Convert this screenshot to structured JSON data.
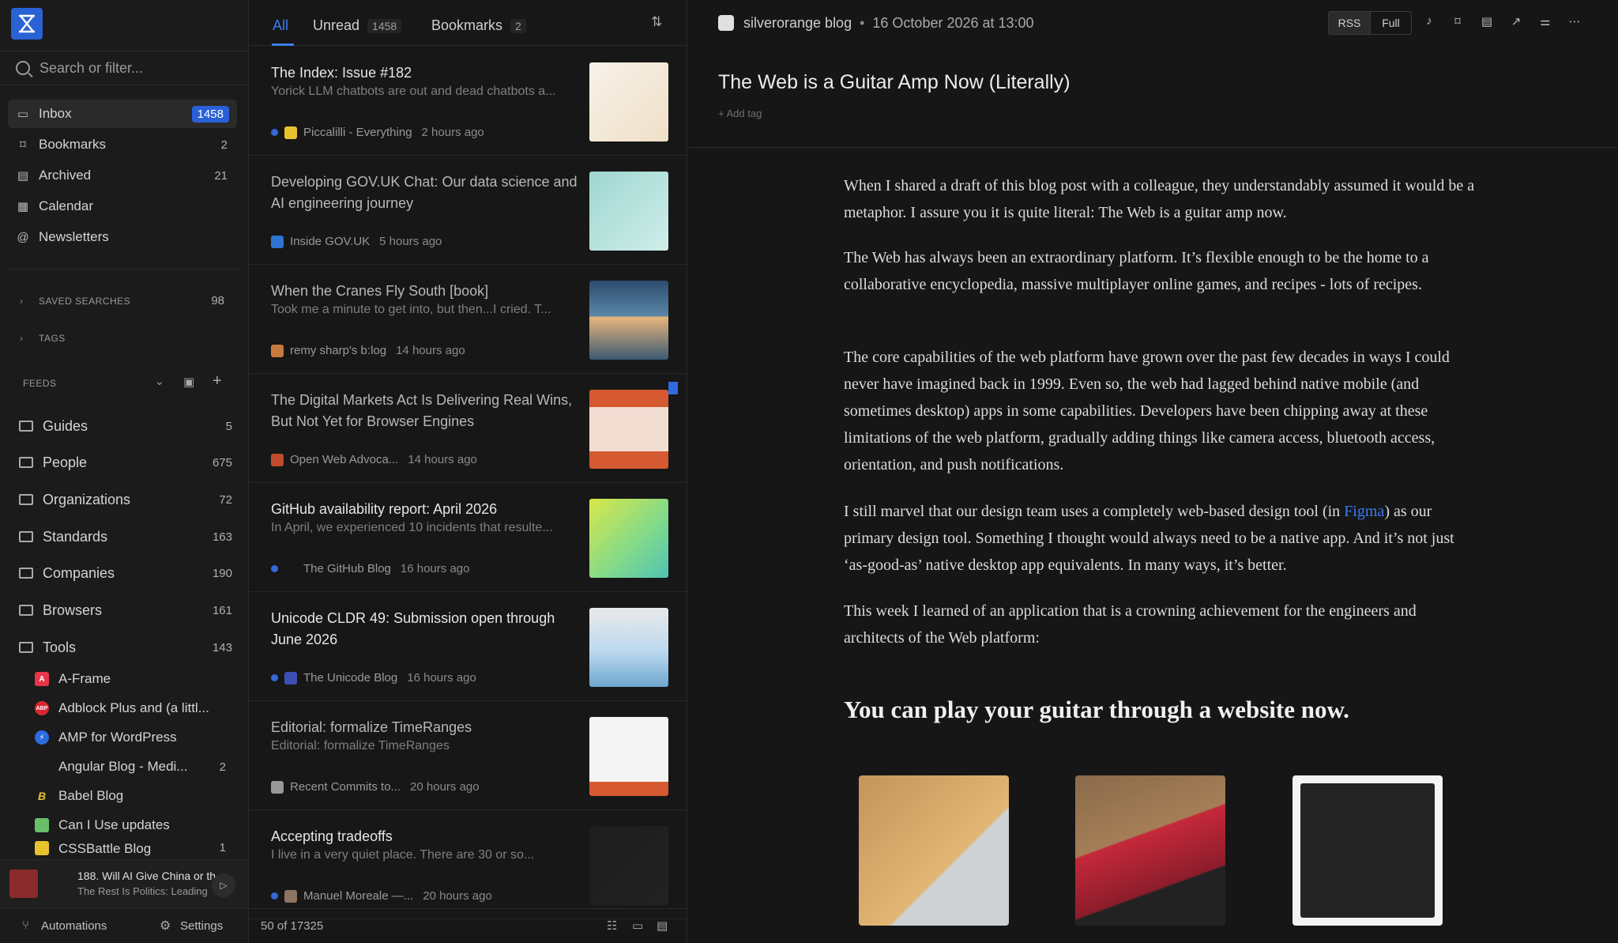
{
  "sidebar": {
    "search_placeholder": "Search or filter...",
    "nav": [
      {
        "label": "Inbox",
        "count": "1458"
      },
      {
        "label": "Bookmarks",
        "count": "2"
      },
      {
        "label": "Archived",
        "count": "21"
      },
      {
        "label": "Calendar",
        "count": ""
      },
      {
        "label": "Newsletters",
        "count": ""
      }
    ],
    "saved_searches": {
      "label": "SAVED SEARCHES",
      "count": "98"
    },
    "tags_label": "TAGS",
    "feeds_label": "FEEDS",
    "folders": [
      {
        "label": "Guides",
        "count": "5"
      },
      {
        "label": "People",
        "count": "675"
      },
      {
        "label": "Organizations",
        "count": "72"
      },
      {
        "label": "Standards",
        "count": "163"
      },
      {
        "label": "Companies",
        "count": "190"
      },
      {
        "label": "Browsers",
        "count": "161"
      },
      {
        "label": "Tools",
        "count": "143"
      }
    ],
    "feeds": [
      {
        "label": "A-Frame",
        "count": "",
        "icon": "A",
        "color": "#e8354a"
      },
      {
        "label": "Adblock Plus and (a littl...",
        "count": "",
        "icon": "ABP",
        "color": "#d7282f"
      },
      {
        "label": "AMP for WordPress",
        "count": "",
        "icon": "⚡",
        "color": "#2b6ce0"
      },
      {
        "label": "Angular Blog - Medi...",
        "count": "2",
        "icon": "",
        "color": "transparent"
      },
      {
        "label": "Babel Blog",
        "count": "",
        "icon": "B",
        "color": "transparent"
      },
      {
        "label": "Can I Use updates",
        "count": "",
        "icon": "",
        "color": "#6abf69"
      },
      {
        "label": "CSSBattle Blog",
        "count": "1",
        "icon": "",
        "color": "#e8c12f"
      }
    ],
    "player": {
      "title": "188. Will AI Give China or th...",
      "subtitle": "The Rest Is Politics: Leading"
    },
    "footer": {
      "automations": "Automations",
      "settings": "Settings"
    }
  },
  "list": {
    "tabs": [
      {
        "label": "All",
        "count": ""
      },
      {
        "label": "Unread",
        "count": "1458"
      },
      {
        "label": "Bookmarks",
        "count": "2"
      }
    ],
    "items": [
      {
        "title": "The Index: Issue #182",
        "excerpt": "Yorick LLM chatbots are out and dead chatbots a...",
        "source": "Piccalilli - Everything",
        "time": "2 hours ago",
        "unread": true,
        "read": false,
        "icon_color": "#e8c12f"
      },
      {
        "title": "Developing GOV.UK Chat: Our data science and AI engineering journey",
        "excerpt": "",
        "source": "Inside GOV.UK",
        "time": "5 hours ago",
        "unread": false,
        "read": true,
        "icon_color": "#2f74d1"
      },
      {
        "title": "When the Cranes Fly South [book]",
        "excerpt": "Took me a minute to get into, but then...I cried. T...",
        "source": "remy sharp's b:log",
        "time": "14 hours ago",
        "unread": false,
        "read": true,
        "icon_color": "#c9793c"
      },
      {
        "title": "The Digital Markets Act Is Delivering Real Wins, But Not Yet for Browser Engines",
        "excerpt": "",
        "source": "Open Web Advoca...",
        "time": "14 hours ago",
        "unread": false,
        "read": true,
        "icon_color": "#c14b2c"
      },
      {
        "title": "GitHub availability report: April 2026",
        "excerpt": "In April, we experienced 10 incidents that resulte...",
        "source": "The GitHub Blog",
        "time": "16 hours ago",
        "unread": true,
        "read": false,
        "icon_color": "transparent"
      },
      {
        "title": "Unicode CLDR 49: Submission open through June 2026",
        "excerpt": "",
        "source": "The Unicode Blog",
        "time": "16 hours ago",
        "unread": true,
        "read": false,
        "icon_color": "#3c4fb4"
      },
      {
        "title": "Editorial: formalize TimeRanges",
        "excerpt": "Editorial: formalize TimeRanges",
        "source": "Recent Commits to...",
        "time": "20 hours ago",
        "unread": false,
        "read": true,
        "icon_color": "#999999"
      },
      {
        "title": "Accepting tradeoffs",
        "excerpt": "I live in a very quiet place. There are 30 or so...",
        "source": "Manuel Moreale —...",
        "time": "20 hours ago",
        "unread": true,
        "read": false,
        "icon_color": "#8d7460"
      }
    ],
    "footer_count": "50 of 17325"
  },
  "reader": {
    "source": "silverorange blog",
    "date": "16 October 2026 at 13:00",
    "buttons": {
      "rss": "RSS",
      "full": "Full"
    },
    "title": "The Web is a Guitar Amp Now (Literally)",
    "add_tag": "+ Add tag",
    "paragraphs": [
      "When I shared a draft of this blog post with a colleague, they understandably assumed it would be a metaphor. I assure you it is quite literal: The Web is a guitar amp now.",
      "The Web has always been an extraordinary platform. It’s flexible enough to be the home to a collaborative encyclopedia, massive multiplayer online games, and recipes - lots of recipes.",
      "The core capabilities of the web platform have grown over the past few decades in ways I could never have imagined back in 1999. Even so, the web had lagged behind native mobile (and sometimes desktop) apps in some capabilities. Developers have been chipping away at these limitations of the web platform, gradually adding things like camera access, bluetooth access, orientation, and push notifications."
    ],
    "p4_before": "I still marvel that our design team uses a completely web-based design tool (in ",
    "p4_link": "Figma",
    "p4_after": ") as our primary design tool. Something I thought would always need to be a native app. And it’s not just ‘as-good-as’ native desktop app equivalents. In many ways, it’s better.",
    "p5": "This week I learned of an application that is a crowning achievement for the engineers and architects of the Web platform:",
    "heading": "You can play your guitar through a website now."
  }
}
